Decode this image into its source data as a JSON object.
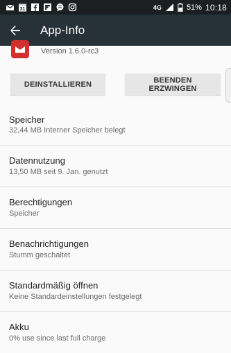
{
  "statusbar": {
    "network": "4G",
    "battery": "51%",
    "time": "10:18",
    "calendar_day": "31",
    "icons": [
      "mail-icon",
      "calendar-icon",
      "facebook-icon",
      "flipboard-icon",
      "chat-icon",
      "instagram-icon"
    ]
  },
  "toolbar": {
    "title": "App-Info"
  },
  "app": {
    "version": "Version 1.6.0-rc3"
  },
  "buttons": {
    "uninstall": "DEINSTALLIEREN",
    "force_stop": "BEENDEN ERZWINGEN"
  },
  "items": [
    {
      "title": "Speicher",
      "subtitle": "32,44 MB Interner Speicher belegt"
    },
    {
      "title": "Datennutzung",
      "subtitle": "13,50 MB seit 9. Jan. genutzt"
    },
    {
      "title": "Berechtigungen",
      "subtitle": "Speicher"
    },
    {
      "title": "Benachrichtigungen",
      "subtitle": "Stumm geschaltet"
    },
    {
      "title": "Standardmäßig öffnen",
      "subtitle": "Keine Standardeinstellungen festgelegt"
    },
    {
      "title": "Akku",
      "subtitle": "0% use since last full charge"
    }
  ],
  "colors": {
    "toolbar": "#263238",
    "statusbar": "#1b1f22",
    "app_icon": "#d32f2f"
  }
}
